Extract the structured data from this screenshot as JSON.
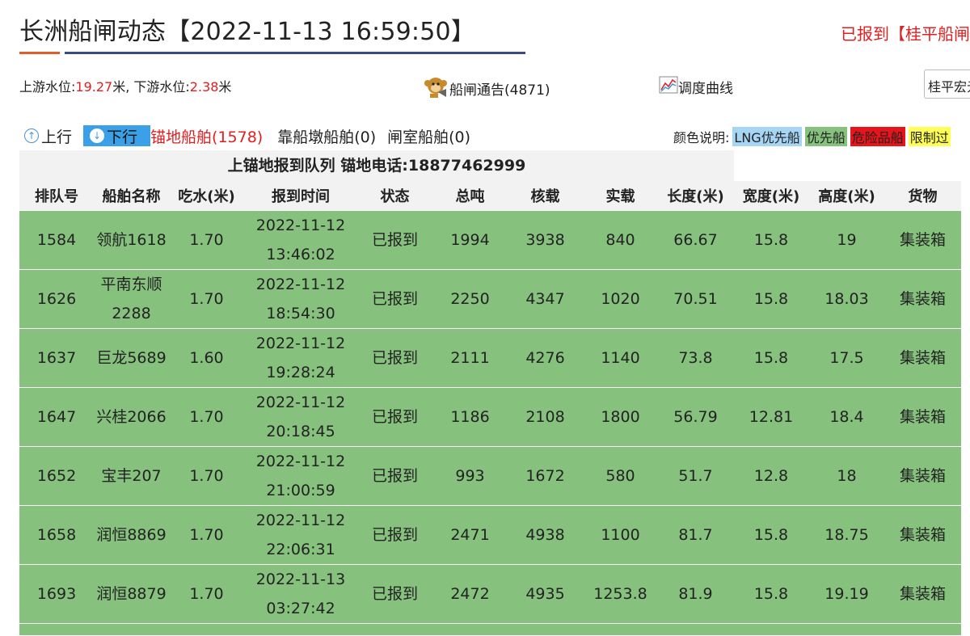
{
  "header": {
    "title": "长洲船闸动态【2022-11-13 16:59:50】",
    "right_status": "已报到【桂平船闸"
  },
  "water": {
    "upstream_label": "上游水位:",
    "upstream_value": "19.27",
    "unit1": "米, 下游水位:",
    "downstream_value": "2.38",
    "unit2": "米"
  },
  "links": {
    "notice_label": "船闸通告(4871)",
    "dispatch_label": "调度曲线",
    "select_value": "桂平宏元"
  },
  "tabs": {
    "up": "上行",
    "down": "下行",
    "anchorage": "锚地船舶(1578)",
    "berth": "靠船墩船舶(0)",
    "chamber": "闸室船舶(0)"
  },
  "legend": {
    "label": "颜色说明:",
    "items": [
      {
        "text": "LNG优先船",
        "bg": "#a7d6f5",
        "color": "#222"
      },
      {
        "text": "优先船",
        "bg": "#86c27e",
        "color": "#222"
      },
      {
        "text": "危险品船",
        "bg": "#e8141c",
        "color": "#222"
      },
      {
        "text": "限制过",
        "bg": "#ffff55",
        "color": "#222"
      }
    ]
  },
  "queue": {
    "title": "上锚地报到队列   锚地电话:18877462999"
  },
  "table": {
    "columns": [
      "排队号",
      "船舶名称",
      "吃水(米)",
      "报到时间",
      "状态",
      "总吨",
      "核载",
      "实载",
      "长度(米)",
      "宽度(米)",
      "高度(米)",
      "货物"
    ],
    "rows": [
      {
        "no": "1584",
        "name1": "领航1618",
        "name2": "",
        "draft": "1.70",
        "date": "2022-11-12",
        "time": "13:46:02",
        "status": "已报到",
        "gt": "1994",
        "cap": "3938",
        "load": "840",
        "len": "66.67",
        "wid": "15.8",
        "hgt": "19",
        "cargo": "集装箱"
      },
      {
        "no": "1626",
        "name1": "平南东顺",
        "name2": "2288",
        "draft": "1.70",
        "date": "2022-11-12",
        "time": "18:54:30",
        "status": "已报到",
        "gt": "2250",
        "cap": "4347",
        "load": "1020",
        "len": "70.51",
        "wid": "15.8",
        "hgt": "18.03",
        "cargo": "集装箱"
      },
      {
        "no": "1637",
        "name1": "巨龙5689",
        "name2": "",
        "draft": "1.60",
        "date": "2022-11-12",
        "time": "19:28:24",
        "status": "已报到",
        "gt": "2111",
        "cap": "4276",
        "load": "1140",
        "len": "73.8",
        "wid": "15.8",
        "hgt": "17.5",
        "cargo": "集装箱"
      },
      {
        "no": "1647",
        "name1": "兴桂2066",
        "name2": "",
        "draft": "1.70",
        "date": "2022-11-12",
        "time": "20:18:45",
        "status": "已报到",
        "gt": "1186",
        "cap": "2108",
        "load": "1800",
        "len": "56.79",
        "wid": "12.81",
        "hgt": "18.4",
        "cargo": "集装箱"
      },
      {
        "no": "1652",
        "name1": "宝丰207",
        "name2": "",
        "draft": "1.70",
        "date": "2022-11-12",
        "time": "21:00:59",
        "status": "已报到",
        "gt": "993",
        "cap": "1672",
        "load": "580",
        "len": "51.7",
        "wid": "12.8",
        "hgt": "18",
        "cargo": "集装箱"
      },
      {
        "no": "1658",
        "name1": "润恒8869",
        "name2": "",
        "draft": "1.70",
        "date": "2022-11-12",
        "time": "22:06:31",
        "status": "已报到",
        "gt": "2471",
        "cap": "4938",
        "load": "1100",
        "len": "81.7",
        "wid": "15.8",
        "hgt": "18.75",
        "cargo": "集装箱"
      },
      {
        "no": "1693",
        "name1": "润恒8879",
        "name2": "",
        "draft": "1.70",
        "date": "2022-11-13",
        "time": "03:27:42",
        "status": "已报到",
        "gt": "2472",
        "cap": "4935",
        "load": "1253.8",
        "len": "81.9",
        "wid": "15.8",
        "hgt": "19.19",
        "cargo": "集装箱"
      }
    ]
  }
}
